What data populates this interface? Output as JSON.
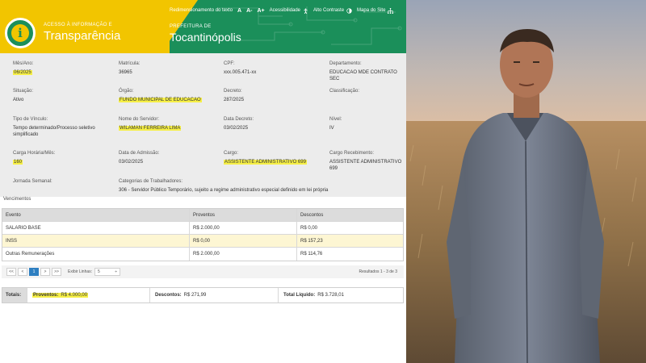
{
  "portal": {
    "logo_subtitle": "ACESSO À INFORMAÇÃO E",
    "logo_title": "Transparência",
    "logo_glyph": "i",
    "prefeitura_subtitle": "PREFEITURA DE",
    "prefeitura_name": "Tocantinópolis",
    "topbar": {
      "redimensionamento": "Redimensionamento do texto",
      "font_a": "A",
      "font_minus": "A-",
      "font_plus": "A+",
      "acessibilidade": "Acessibilidade",
      "alto_contraste": "Alto Contraste",
      "mapa_site": "Mapa do Site"
    },
    "colors": {
      "green": "#1b8f5a",
      "yellow": "#f2c500",
      "highlight": "#f6ef46"
    },
    "fields": {
      "mes_ano": {
        "label": "Mês/Ano:",
        "value": "06/2025"
      },
      "matricula": {
        "label": "Matrícula:",
        "value": "36965"
      },
      "cpf": {
        "label": "CPF:",
        "value": "xxx.005.471-xx"
      },
      "departamento": {
        "label": "Departamento:",
        "value": "EDUCACAO MDE CONTRATO SEC"
      },
      "situacao": {
        "label": "Situação:",
        "value": "Ativo"
      },
      "orgao": {
        "label": "Órgão:",
        "value": "FUNDO MUNICIPAL DE EDUCACAO"
      },
      "decreto": {
        "label": "Decreto:",
        "value": "287/2025"
      },
      "classificacao": {
        "label": "Classificação:",
        "value": ""
      },
      "tipo_vinculo": {
        "label": "Tipo de Vínculo:",
        "value": "Tempo determinado/Processo seletivo simplificado"
      },
      "nome_servidor": {
        "label": "Nome do Servidor:",
        "value": "WILAMAN FERREIRA LIMA"
      },
      "data_decreto": {
        "label": "Data Decreto:",
        "value": "03/02/2025"
      },
      "nivel": {
        "label": "Nível:",
        "value": "IV"
      },
      "carga_horaria": {
        "label": "Carga Horária/Mês:",
        "value": "160"
      },
      "data_admissao": {
        "label": "Data de Admissão:",
        "value": "03/02/2025"
      },
      "cargo": {
        "label": "Cargo:",
        "value": "ASSISTENTE ADMINISTRATIVO 699"
      },
      "cargo_recebimento": {
        "label": "Cargo Recebimento:",
        "value": "ASSISTENTE ADMINISTRATIVO 699"
      },
      "jornada_semanal": {
        "label": "Jornada Semanal:",
        "value": ""
      },
      "categorias": {
        "label": "Categorias de Trabalhadores:",
        "value": "306 - Servidor Público Temporário, sujeito a regime administrativo especial definido em lei própria"
      }
    },
    "section_label": "Vencimentos",
    "table": {
      "headers": [
        "Evento",
        "Proventos",
        "Descontos"
      ],
      "rows": [
        [
          "SALARIO BASE",
          "R$ 2.000,00",
          "R$ 0,00"
        ],
        [
          "INSS",
          "R$ 0,00",
          "R$ 157,23"
        ],
        [
          "Outras Remunerações",
          "R$ 2.000,00",
          "R$ 114,76"
        ]
      ]
    },
    "pager": {
      "first": "<<",
      "prev": "<",
      "current": "1",
      "next": ">",
      "last": ">>",
      "rows_label": "Exibir Linhas:",
      "rows_value": "5",
      "rows_caret": "÷",
      "result": "Resultados 1 - 3 de 3"
    },
    "totals": {
      "label": "Totais:",
      "proventos_label": "Proventos:",
      "proventos_value": "R$ 4.000,00",
      "descontos_label": "Descontos:",
      "descontos_value": "R$ 271,99",
      "liquido_label": "Total Líquido:",
      "liquido_value": "R$ 3.728,01"
    }
  },
  "photo": {
    "sky_top": "#aab2c2",
    "horizon": "#d6b8a0",
    "field": "#9a7a52",
    "shirt": "#6e7686"
  }
}
